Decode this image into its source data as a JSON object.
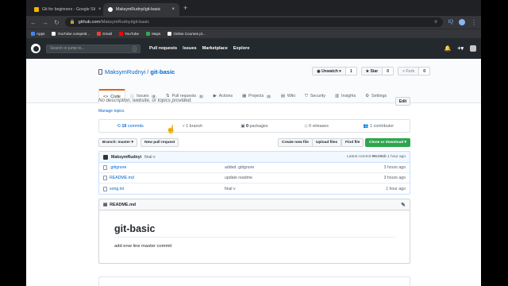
{
  "browser": {
    "tabs": [
      {
        "label": "Git for beginners - Google Sli"
      },
      {
        "label": "MaksymRudnyi/git-basic"
      }
    ],
    "url_host": "github.com",
    "url_path": "/MaksymRudnyi/git-basic",
    "bookmarks": [
      {
        "label": "Apps",
        "color": "#4285f4"
      },
      {
        "label": "YouTube competit...",
        "color": "#f1f3f4"
      },
      {
        "label": "Gmail",
        "color": "#ea4335"
      },
      {
        "label": "YouTube",
        "color": "#ff0000"
      },
      {
        "label": "Maps",
        "color": "#34a853"
      },
      {
        "label": "Online Courses pl...",
        "color": "#f1f3f4"
      }
    ]
  },
  "header": {
    "search_placeholder": "Search or jump to...",
    "search_key": "/",
    "nav": [
      "Pull requests",
      "Issues",
      "Marketplace",
      "Explore"
    ]
  },
  "repo": {
    "owner": "MaksymRudnyi",
    "name": "git-basic",
    "watch": {
      "label": "Unwatch",
      "count": "1"
    },
    "star": {
      "label": "Star",
      "count": "0"
    },
    "fork": {
      "label": "Fork",
      "count": "0"
    },
    "tabs": [
      {
        "label": "Code",
        "count": ""
      },
      {
        "label": "Issues",
        "count": "0"
      },
      {
        "label": "Pull requests",
        "count": "0"
      },
      {
        "label": "Actions",
        "count": ""
      },
      {
        "label": "Projects",
        "count": "0"
      },
      {
        "label": "Wiki",
        "count": ""
      },
      {
        "label": "Security",
        "count": ""
      },
      {
        "label": "Insights",
        "count": ""
      },
      {
        "label": "Settings",
        "count": ""
      }
    ],
    "description": "No description, website, or topics provided.",
    "edit_label": "Edit",
    "manage_topics": "Manage topics",
    "summary": {
      "commits_num": "19",
      "commits_word": "commits",
      "branch": "1 branch",
      "packages_num": "0",
      "packages_word": "packages",
      "releases": "0 releases",
      "contributor": "1 contributor"
    },
    "branch_label": "Branch: master",
    "new_pr": "New pull request",
    "create_file": "Create new file",
    "upload": "Upload files",
    "find": "Find file",
    "clone": "Clone or download",
    "latest_commit": {
      "author": "MaksymRudnyi",
      "message": "final v",
      "prefix": "Latest commit",
      "sha": "99c491b",
      "age": "1 hour ago"
    },
    "files": [
      {
        "name": ".gitignore",
        "message": "added .gitignore",
        "age": "3 hours ago"
      },
      {
        "name": "README.md",
        "message": "update readme",
        "age": "3 hours ago"
      },
      {
        "name": "song.txt",
        "message": "final v",
        "age": "1 hour ago"
      }
    ],
    "readme": {
      "filename": "README.md",
      "heading": "git-basic",
      "body": "add enw line master commit"
    }
  },
  "colors": {
    "accent": "#0366d6",
    "brand_dark": "#24292e",
    "clone_green": "#2ea44f",
    "tab_underline": "#e36209"
  }
}
